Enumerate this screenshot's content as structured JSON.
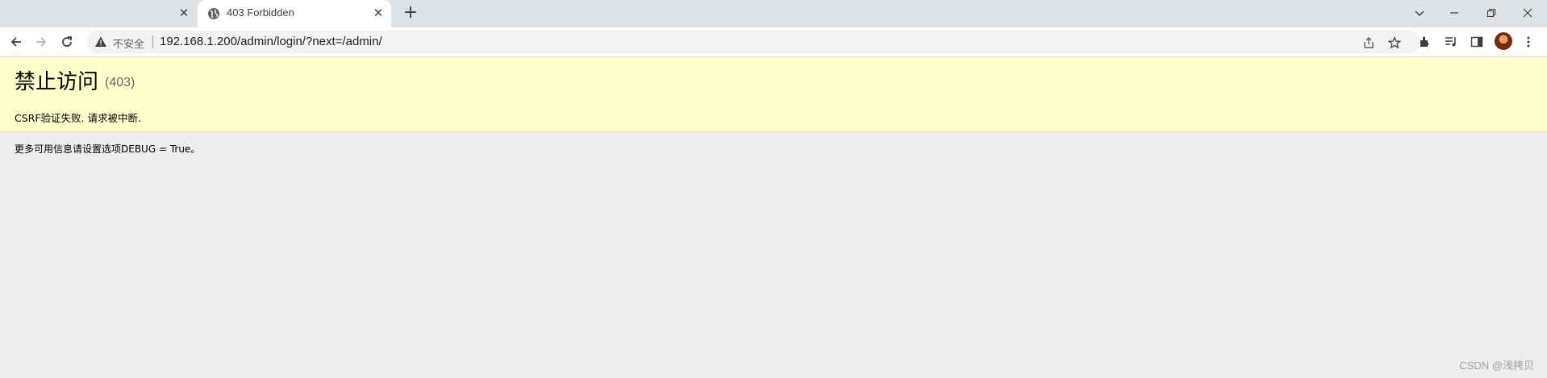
{
  "browser": {
    "tabs": [
      {
        "title": ""
      },
      {
        "title": "403 Forbidden",
        "active": true
      }
    ],
    "address": {
      "security_label": "不安全",
      "url": "192.168.1.200/admin/login/?next=/admin/"
    }
  },
  "page": {
    "heading": "禁止访问",
    "status_code": "(403)",
    "reason": "CSRF验证失败. 请求被中断.",
    "info": "更多可用信息请设置选项DEBUG = True。"
  },
  "watermark": "CSDN @浅拷贝",
  "colors": {
    "summary_bg": "#ffffcc",
    "page_bg": "#eeeded",
    "tabstrip_bg": "#dee1e6"
  }
}
